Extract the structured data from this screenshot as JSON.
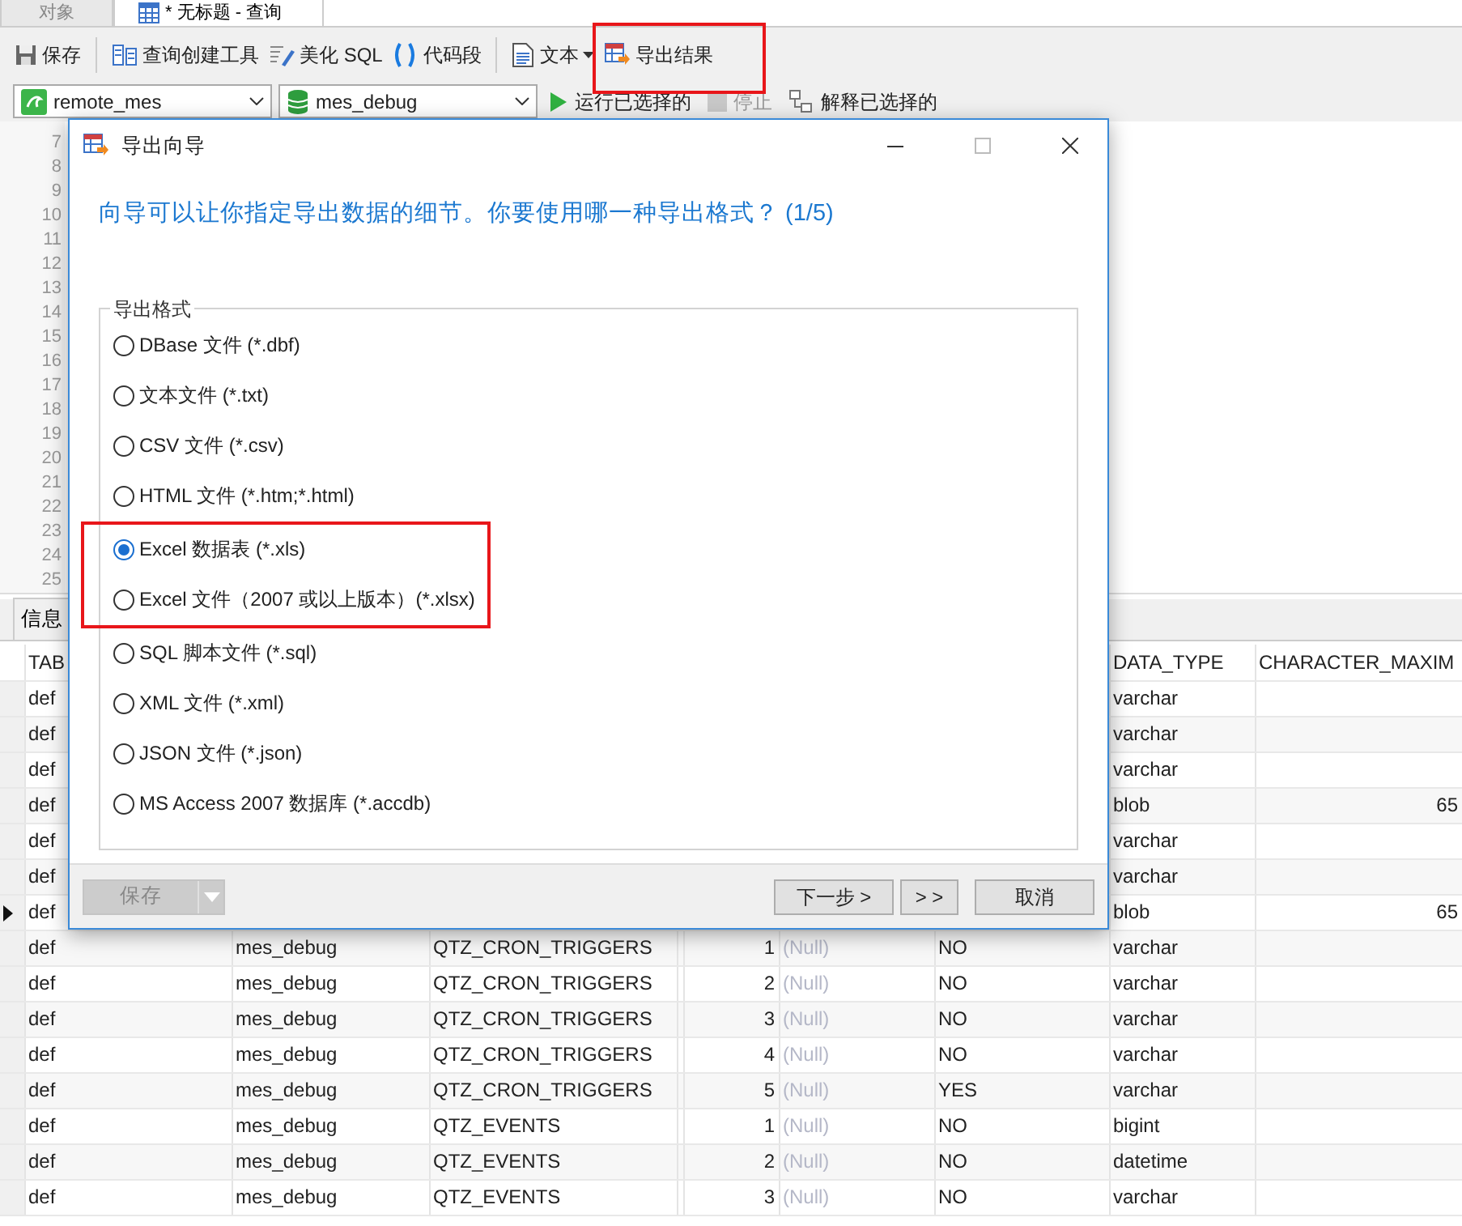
{
  "tabs": [
    {
      "label": "对象",
      "selected": false
    },
    {
      "label": "* 无标题 - 查询",
      "selected": true
    }
  ],
  "toolbar": [
    {
      "kind": "button",
      "label": "保存",
      "highlighted": false
    },
    {
      "kind": "separator"
    },
    {
      "kind": "button",
      "label": "查询创建工具",
      "highlighted": false
    },
    {
      "kind": "button",
      "label": "美化 SQL",
      "highlighted": false
    },
    {
      "kind": "button",
      "label": "代码段",
      "highlighted": false
    },
    {
      "kind": "separator"
    },
    {
      "kind": "dropdown",
      "label": "文本",
      "highlighted": false
    },
    {
      "kind": "button",
      "label": "导出结果",
      "highlighted": true
    }
  ],
  "connection_bar": {
    "combos": [
      {
        "value": "remote_mes"
      },
      {
        "value": "mes_debug"
      }
    ],
    "actions": [
      {
        "label": "运行已选择的",
        "disabled": false
      },
      {
        "label": "停止",
        "disabled": true
      },
      {
        "label": "解释已选择的",
        "disabled": false
      }
    ]
  },
  "editor": {
    "line_numbers": [
      "7",
      "8",
      "9",
      "10",
      "11",
      "12",
      "13",
      "14",
      "15",
      "16",
      "17",
      "18",
      "19",
      "20",
      "21",
      "22",
      "23",
      "24",
      "25"
    ]
  },
  "result_tabs": [
    {
      "label": "信息",
      "selected": false
    }
  ],
  "grid": {
    "header": {
      "column_1": "TAB",
      "column_8": "DATA_TYPE",
      "column_9": "CHARACTER_MAXIM"
    },
    "rows": [
      {
        "current": false,
        "column_1": "def",
        "column_8": "varchar"
      },
      {
        "current": false,
        "column_1": "def",
        "column_8": "varchar"
      },
      {
        "current": false,
        "column_1": "def",
        "column_8": "varchar"
      },
      {
        "current": false,
        "column_1": "def",
        "column_8": "blob",
        "column_9": "65"
      },
      {
        "current": false,
        "column_1": "def",
        "column_8": "varchar"
      },
      {
        "current": false,
        "column_1": "def",
        "column_8": "varchar"
      },
      {
        "current": true,
        "column_1": "def",
        "column_8": "blob",
        "column_9": "65"
      },
      {
        "current": false,
        "column_1": "def",
        "column_2": "mes_debug",
        "column_3": "QTZ_CRON_TRIGGERS",
        "column_5": "1",
        "column_6": "(Null)",
        "column_7": "NO",
        "column_8": "varchar"
      },
      {
        "current": false,
        "column_1": "def",
        "column_2": "mes_debug",
        "column_3": "QTZ_CRON_TRIGGERS",
        "column_5": "2",
        "column_6": "(Null)",
        "column_7": "NO",
        "column_8": "varchar"
      },
      {
        "current": false,
        "column_1": "def",
        "column_2": "mes_debug",
        "column_3": "QTZ_CRON_TRIGGERS",
        "column_5": "3",
        "column_6": "(Null)",
        "column_7": "NO",
        "column_8": "varchar"
      },
      {
        "current": false,
        "column_1": "def",
        "column_2": "mes_debug",
        "column_3": "QTZ_CRON_TRIGGERS",
        "column_5": "4",
        "column_6": "(Null)",
        "column_7": "NO",
        "column_8": "varchar"
      },
      {
        "current": false,
        "column_1": "def",
        "column_2": "mes_debug",
        "column_3": "QTZ_CRON_TRIGGERS",
        "column_5": "5",
        "column_6": "(Null)",
        "column_7": "YES",
        "column_8": "varchar"
      },
      {
        "current": false,
        "column_1": "def",
        "column_2": "mes_debug",
        "column_3": "QTZ_EVENTS",
        "column_5": "1",
        "column_6": "(Null)",
        "column_7": "NO",
        "column_8": "bigint"
      },
      {
        "current": false,
        "column_1": "def",
        "column_2": "mes_debug",
        "column_3": "QTZ_EVENTS",
        "column_5": "2",
        "column_6": "(Null)",
        "column_7": "NO",
        "column_8": "datetime"
      },
      {
        "current": false,
        "column_1": "def",
        "column_2": "mes_debug",
        "column_3": "QTZ_EVENTS",
        "column_5": "3",
        "column_6": "(Null)",
        "column_7": "NO",
        "column_8": "varchar"
      }
    ]
  },
  "dialog": {
    "title": "导出向导",
    "heading": "向导可以让你指定导出数据的细节。你要使用哪一种导出格式？ (1/5)",
    "group_label": "导出格式",
    "formats": [
      {
        "label": "DBase 文件 (*.dbf)",
        "selected": false,
        "boxed": false
      },
      {
        "label": "文本文件 (*.txt)",
        "selected": false,
        "boxed": false
      },
      {
        "label": "CSV 文件 (*.csv)",
        "selected": false,
        "boxed": false
      },
      {
        "label": "HTML 文件 (*.htm;*.html)",
        "selected": false,
        "boxed": false
      },
      {
        "label": "Excel 数据表 (*.xls)",
        "selected": true,
        "boxed": true
      },
      {
        "label": "Excel 文件（2007 或以上版本）(*.xlsx)",
        "selected": false,
        "boxed": true
      },
      {
        "label": "SQL 脚本文件 (*.sql)",
        "selected": false,
        "boxed": false
      },
      {
        "label": "XML 文件 (*.xml)",
        "selected": false,
        "boxed": false
      },
      {
        "label": "JSON 文件 (*.json)",
        "selected": false,
        "boxed": false
      },
      {
        "label": "MS Access 2007 数据库 (*.accdb)",
        "selected": false,
        "boxed": false
      }
    ],
    "save_button": {
      "label": "保存",
      "disabled": true
    },
    "buttons": [
      {
        "label": "下一步 >"
      },
      {
        "label": "> >"
      },
      {
        "label": "取消"
      }
    ]
  }
}
